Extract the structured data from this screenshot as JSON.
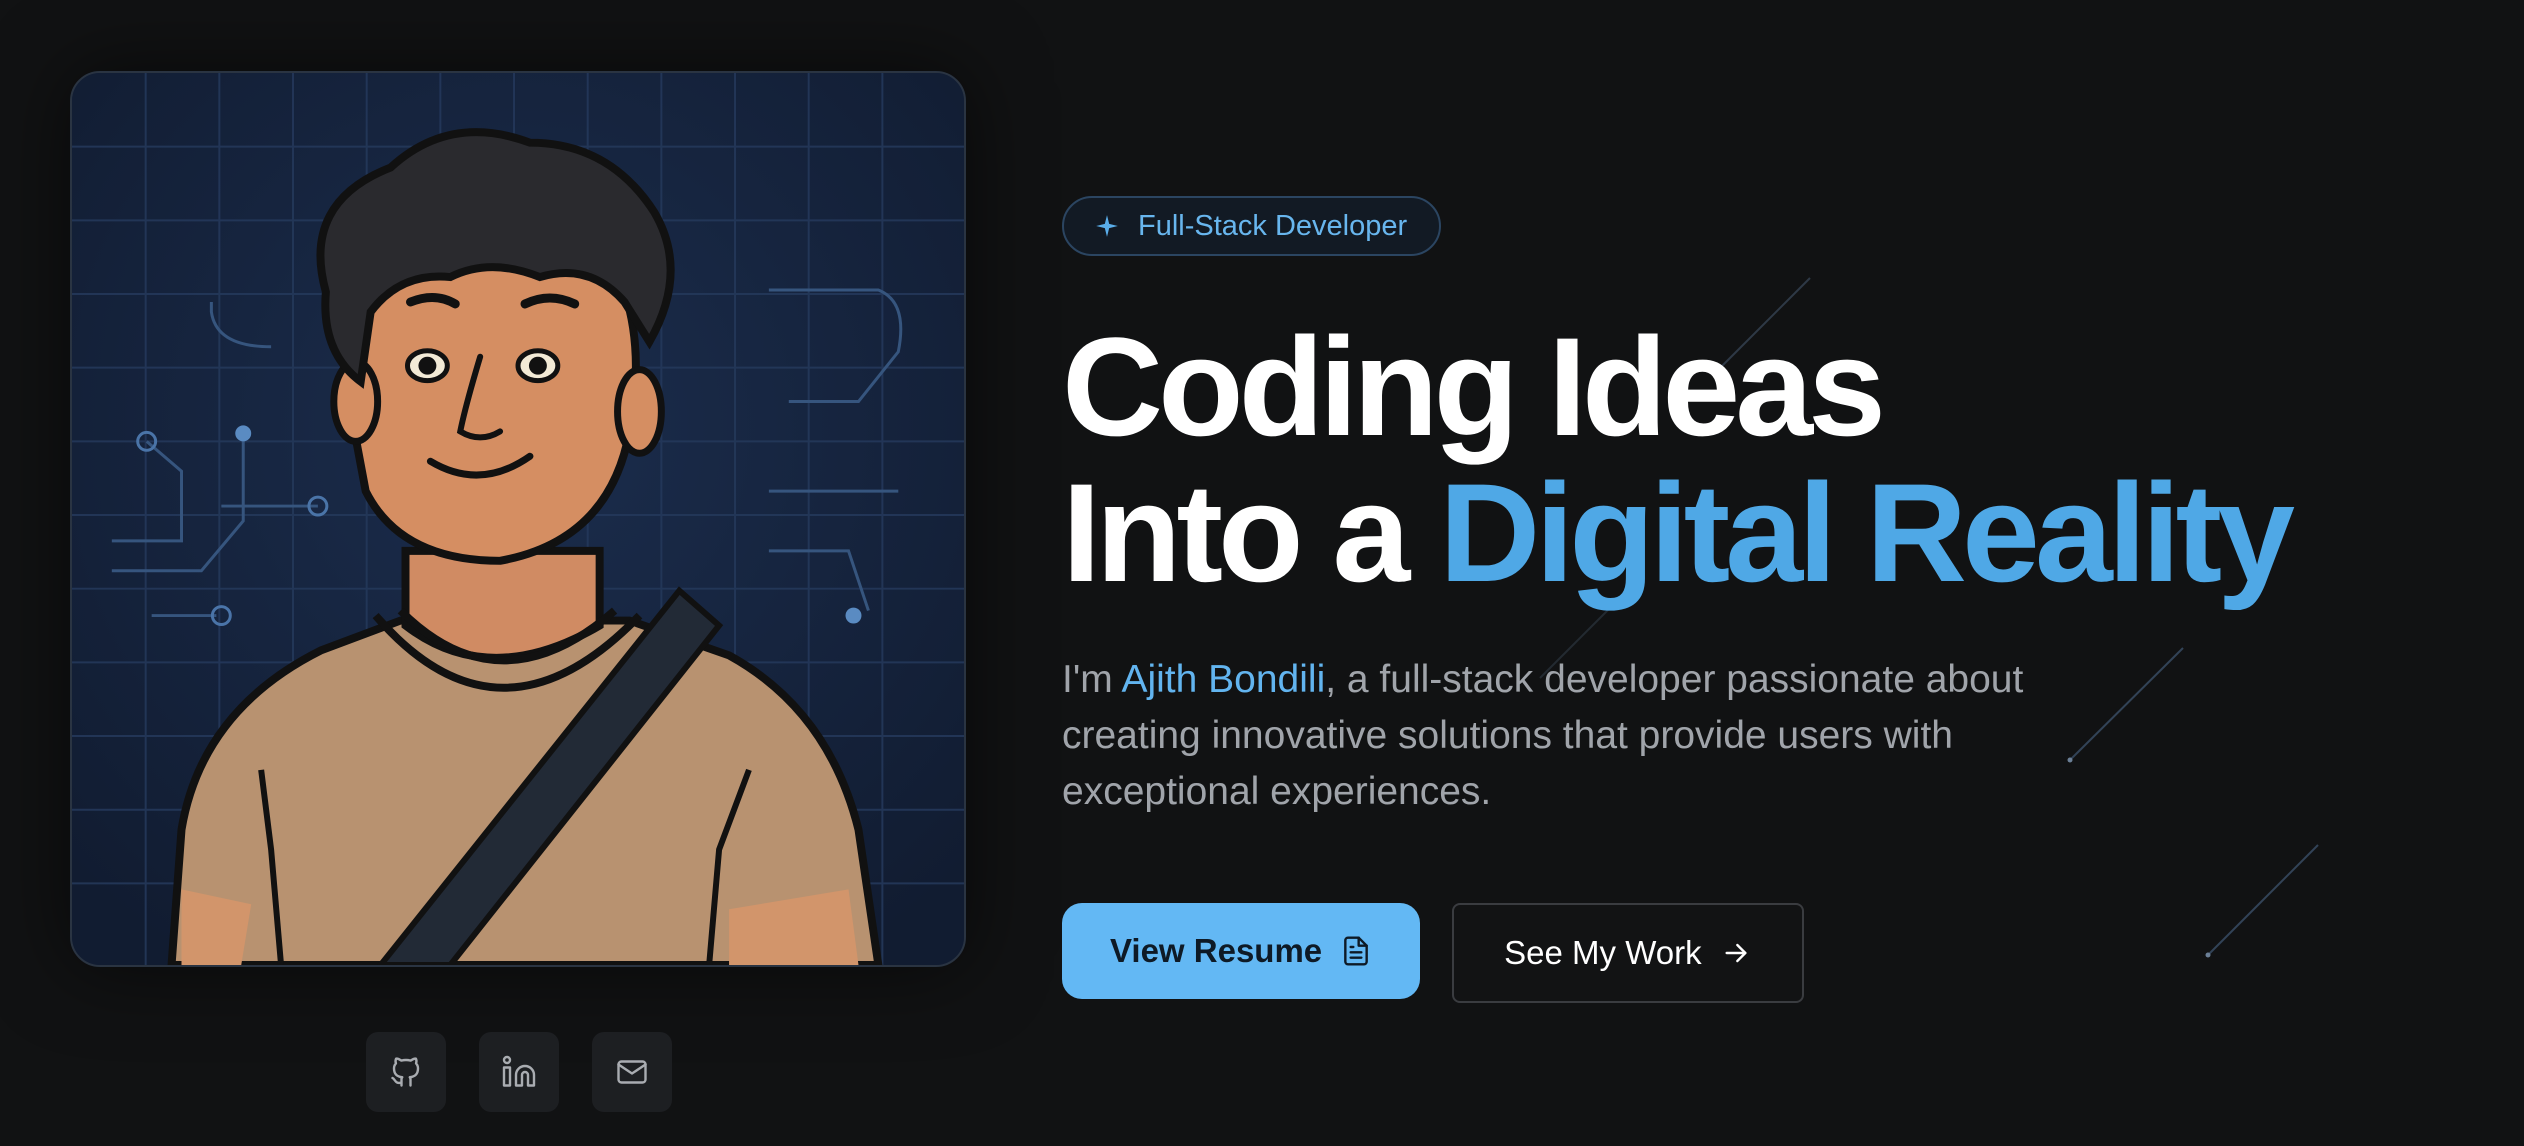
{
  "badge": {
    "icon": "sparkle-icon",
    "label": "Full-Stack Developer"
  },
  "headline": {
    "line1": "Coding Ideas",
    "line2_prefix": "Into a ",
    "line2_accent": "Digital Reality"
  },
  "intro": {
    "prefix": "I'm ",
    "name": "Ajith Bondili",
    "suffix": ", a full-stack developer passionate about creating innovative solutions that provide users with exceptional experiences."
  },
  "actions": {
    "primary": {
      "label": "View Resume",
      "icon": "document-icon"
    },
    "secondary": {
      "label": "See My Work",
      "icon": "arrow-right-icon"
    }
  },
  "socials": [
    {
      "name": "github",
      "icon": "github-icon"
    },
    {
      "name": "linkedin",
      "icon": "linkedin-icon"
    },
    {
      "name": "email",
      "icon": "mail-icon"
    }
  ],
  "colors": {
    "background": "#111213",
    "accent": "#4fa8e6",
    "button_primary": "#63b8f4",
    "text_muted": "#a0a4aa"
  }
}
